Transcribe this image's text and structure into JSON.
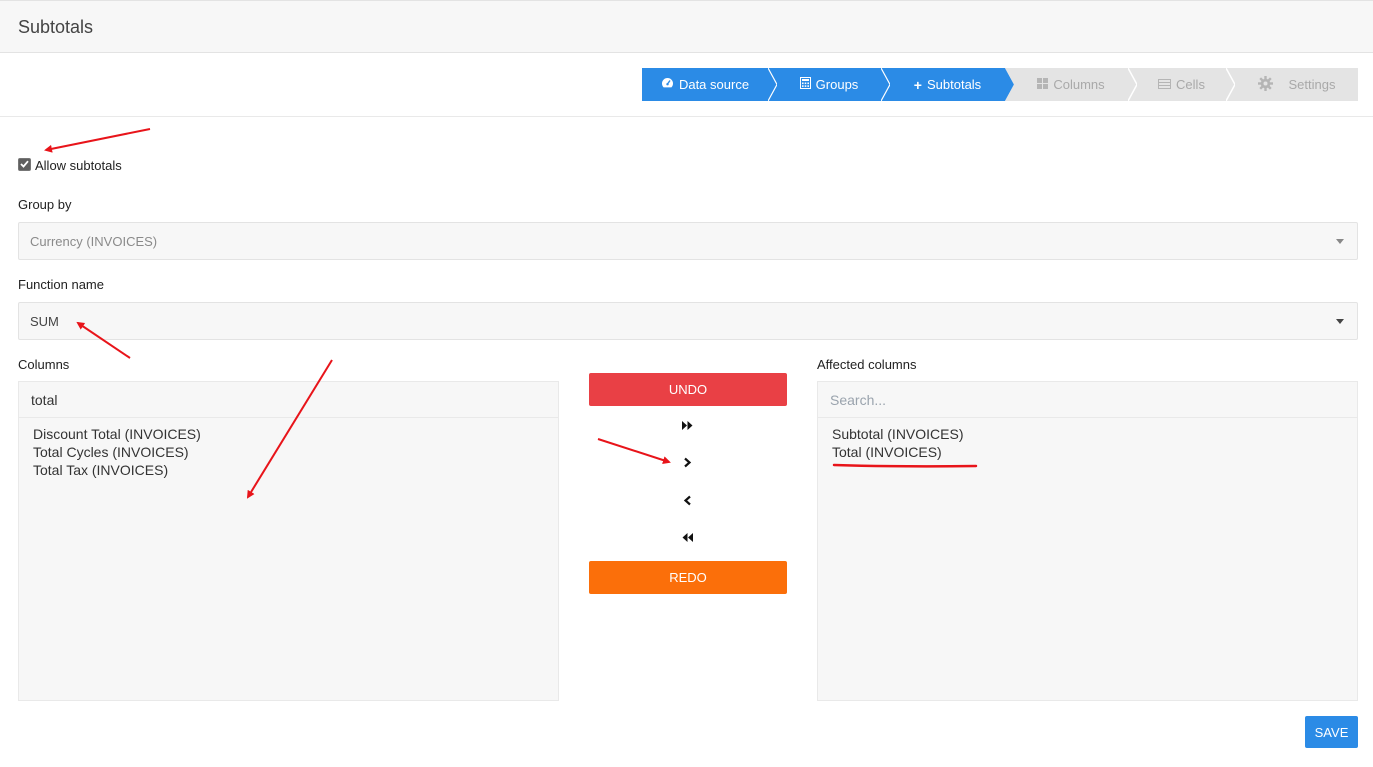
{
  "page": {
    "title": "Subtotals"
  },
  "wizard": {
    "steps": [
      {
        "label": "Data source",
        "icon": "dashboard-icon",
        "state": "active"
      },
      {
        "label": "Groups",
        "icon": "calculator-icon",
        "state": "active"
      },
      {
        "label": "Subtotals",
        "icon": "plus-icon",
        "state": "active"
      },
      {
        "label": "Columns",
        "icon": "grid-icon",
        "state": "disabled"
      },
      {
        "label": "Cells",
        "icon": "list-icon",
        "state": "disabled"
      },
      {
        "label": "Settings",
        "icon": "gear-icon",
        "state": "disabled"
      }
    ]
  },
  "form": {
    "allow_subtotals": {
      "label": "Allow subtotals",
      "checked": true
    },
    "group_by": {
      "label": "Group by",
      "value": "Currency (INVOICES)"
    },
    "function_name": {
      "label": "Function name",
      "value": "SUM"
    }
  },
  "columns": {
    "label": "Columns",
    "search_value": "total",
    "items": [
      "Discount Total (INVOICES)",
      "Total Cycles (INVOICES)",
      "Total Tax (INVOICES)"
    ]
  },
  "affected": {
    "label": "Affected columns",
    "search_placeholder": "Search...",
    "items": [
      "Subtotal (INVOICES)",
      "Total (INVOICES)"
    ]
  },
  "actions": {
    "undo_label": "UNDO",
    "redo_label": "REDO",
    "save_label": "SAVE",
    "move_icons": [
      "double-chevron-right-icon",
      "chevron-right-icon",
      "chevron-left-icon",
      "double-chevron-left-icon"
    ]
  },
  "colors": {
    "primary": "#2b8be6",
    "undo": "#e94045",
    "redo": "#fb6f0a",
    "annotation": "#e8141a"
  }
}
